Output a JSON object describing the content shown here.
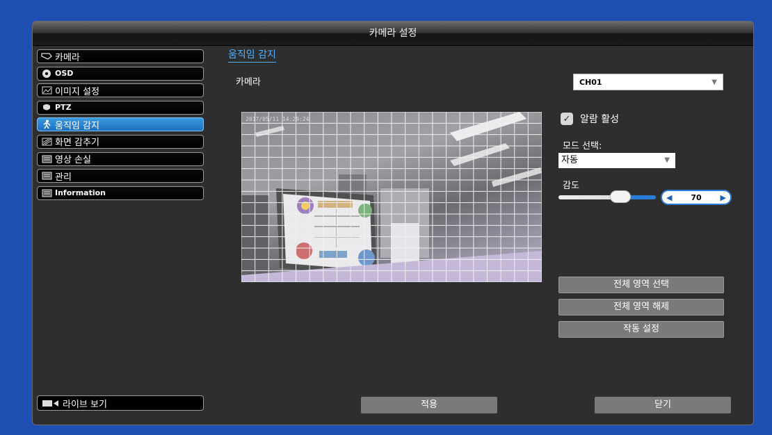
{
  "window": {
    "title": "카메라 설정"
  },
  "sidebar": {
    "items": [
      {
        "label": "카메라",
        "icon": "camera-icon"
      },
      {
        "label": "OSD",
        "icon": "osd-icon"
      },
      {
        "label": "이미지 설정",
        "icon": "image-icon"
      },
      {
        "label": "PTZ",
        "icon": "ptz-icon"
      },
      {
        "label": "움직임 감지",
        "icon": "motion-icon",
        "active": true
      },
      {
        "label": "화면 감추기",
        "icon": "mask-icon"
      },
      {
        "label": "영상 손실",
        "icon": "video-loss-icon"
      },
      {
        "label": "관리",
        "icon": "manage-icon"
      },
      {
        "label": "Information",
        "icon": "info-icon"
      }
    ],
    "live_view": "라이브 보기"
  },
  "main": {
    "section_title": "움직임 감지",
    "camera_label": "카메라",
    "camera_value": "CH01",
    "timestamp": "2017/05/11 14:29:24",
    "alarm_label": "알람 활성",
    "alarm_checked": true,
    "mode_label": "모드 선택:",
    "mode_value": "자동",
    "sensitivity_label": "감도",
    "sensitivity_value": "70",
    "select_all": "전체 영역 선택",
    "clear_all": "전체 영역 해제",
    "operation_settings": "작동 설정"
  },
  "footer": {
    "apply": "적용",
    "close": "닫기"
  },
  "colors": {
    "background": "#1f4fb3",
    "accent": "#4fb0ff",
    "active": "#2a7dd6"
  }
}
